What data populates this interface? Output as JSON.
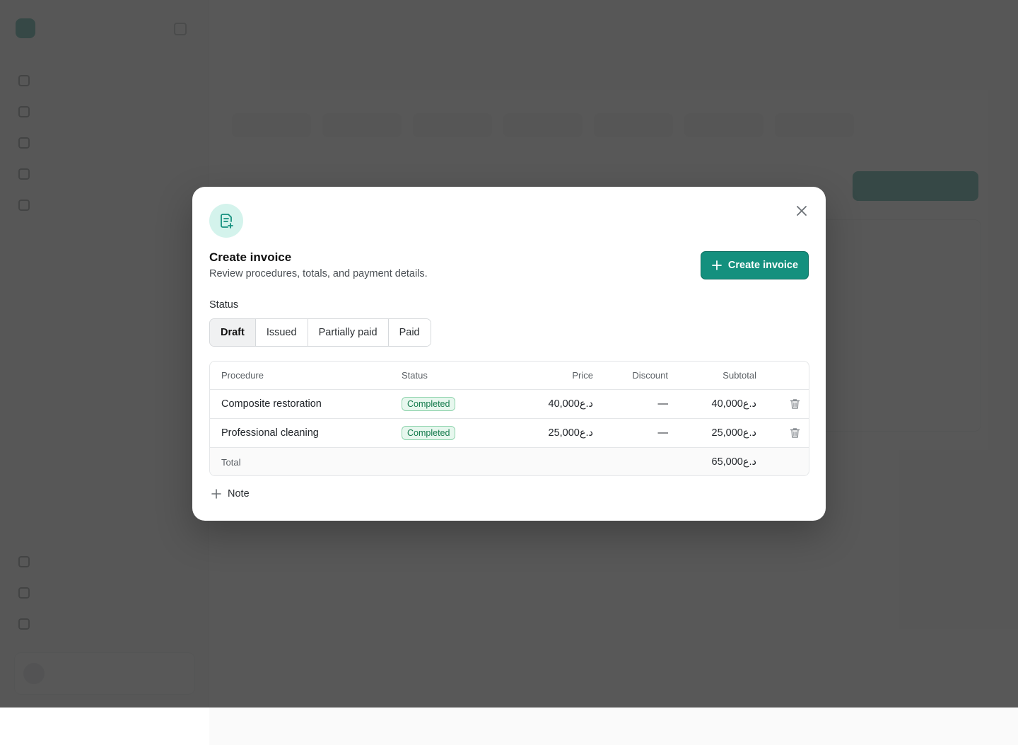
{
  "colors": {
    "accent": "#14907e",
    "badge_text": "#137a4b",
    "badge_bg": "#e7f7ee",
    "overlay": "rgba(60,60,60,0.86)"
  },
  "modal": {
    "icon": "invoice-add-icon",
    "title": "Create invoice",
    "subtitle": "Review procedures, totals, and payment details.",
    "create_button_label": "Create invoice",
    "status_label": "Status",
    "status_options": [
      "Draft",
      "Issued",
      "Partially paid",
      "Paid"
    ],
    "selected_status": "Draft",
    "table": {
      "headers": {
        "procedure": "Procedure",
        "status": "Status",
        "price": "Price",
        "discount": "Discount",
        "subtotal": "Subtotal"
      },
      "rows": [
        {
          "procedure": "Composite restoration",
          "status": "Completed",
          "price": "40,000د.ع",
          "discount": "—",
          "subtotal": "40,000د.ع"
        },
        {
          "procedure": "Professional cleaning",
          "status": "Completed",
          "price": "25,000د.ع",
          "discount": "—",
          "subtotal": "25,000د.ع"
        }
      ],
      "total_label": "Total",
      "total_value": "65,000د.ع"
    },
    "note_label": "Note"
  }
}
